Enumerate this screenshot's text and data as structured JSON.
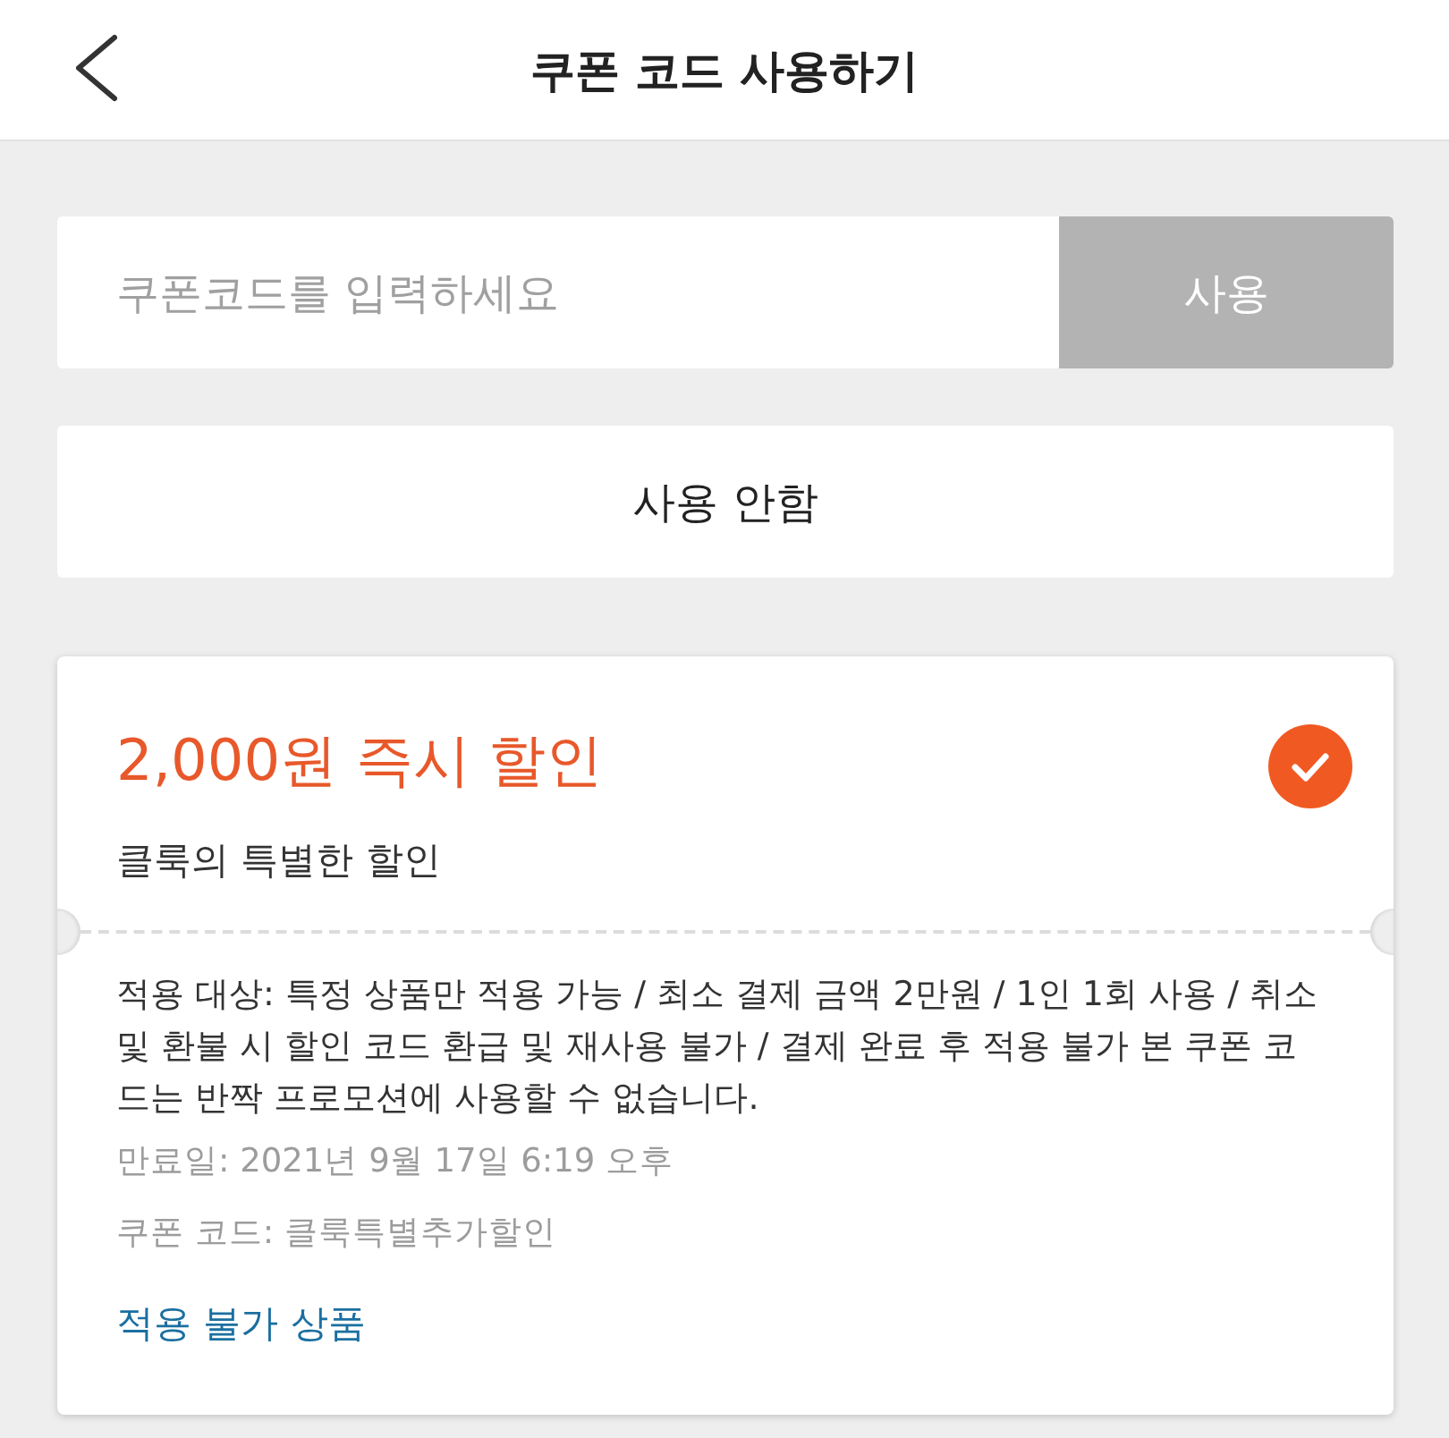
{
  "header": {
    "title": "쿠폰 코드 사용하기"
  },
  "code_entry": {
    "placeholder": "쿠폰코드를 입력하세요",
    "apply_button": {
      "label": "사용",
      "disabled": true
    }
  },
  "no_coupon_button": {
    "label": "사용 안함"
  },
  "coupons": [
    {
      "title": "2,000원 즉시 할인",
      "subtitle": "클룩의 특별한 할인",
      "selected": true,
      "description": "적용 대상: 특정 상품만 적용 가능 / 최소 결제 금액 2만원 / 1인 1회 사용 / 취소 및 환불 시 할인 코드 환급 및 재사용 불가 / 결제 완료 후 적용 불가 본 쿠폰 코드는 반짝 프로모션에 사용할 수 없습니다.",
      "expiry": "만료일: 2021년 9월 17일 6:19 오후",
      "code": "쿠폰 코드: 클룩특별추가할인",
      "link": "적용 불가 상품"
    }
  ]
}
